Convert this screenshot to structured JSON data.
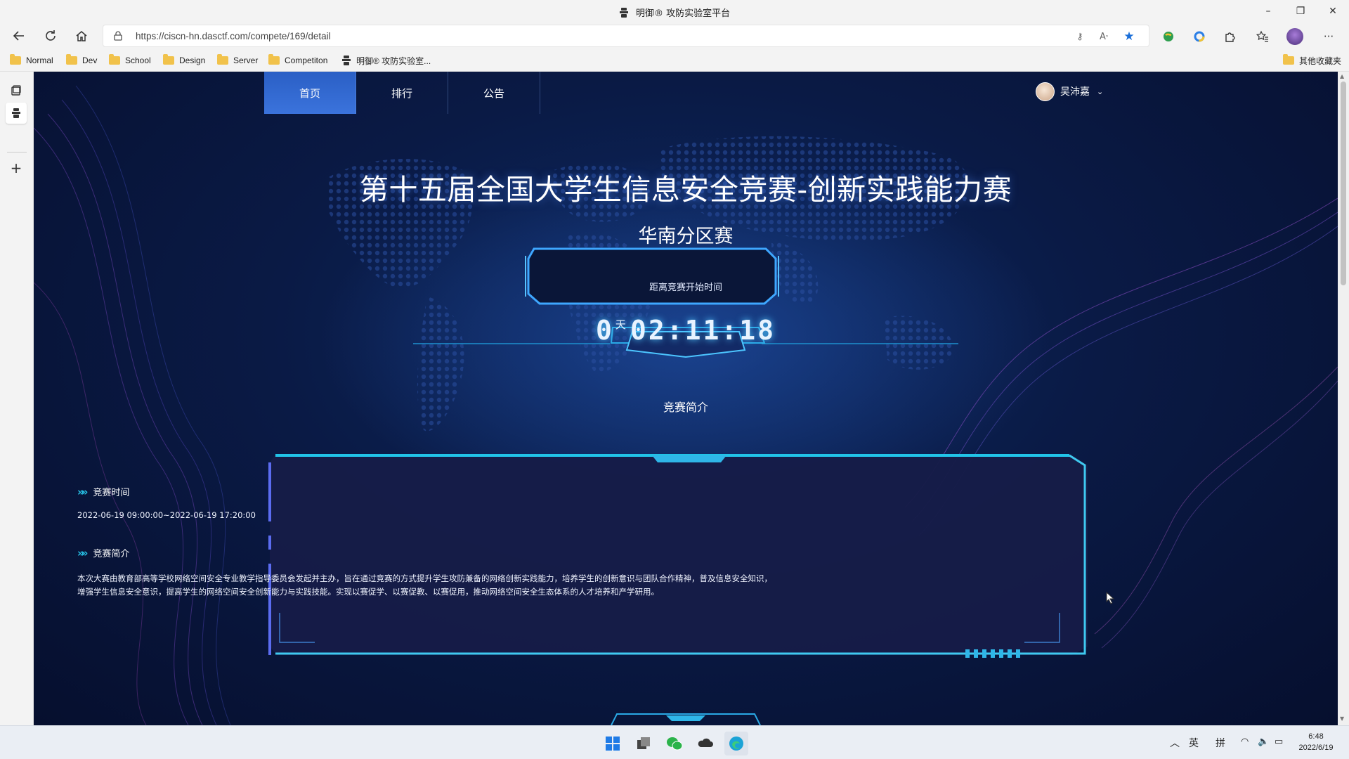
{
  "window": {
    "title": "明御® 攻防实验室平台",
    "controls": {
      "minimize": "–",
      "maximize": "❐",
      "close": "✕"
    }
  },
  "address_bar": {
    "url": "https://ciscn-hn.dasctf.com/compete/169/detail"
  },
  "bookmarks": [
    {
      "label": "Normal",
      "icon": "folder-icon"
    },
    {
      "label": "Dev",
      "icon": "folder-icon"
    },
    {
      "label": "School",
      "icon": "folder-icon"
    },
    {
      "label": "Design",
      "icon": "folder-icon"
    },
    {
      "label": "Server",
      "icon": "folder-icon"
    },
    {
      "label": "Competiton",
      "icon": "folder-icon"
    },
    {
      "label": "明御® 攻防实验室...",
      "icon": "site-logo-icon"
    }
  ],
  "other_bookmarks": "其他收藏夹",
  "site_nav": {
    "tabs": [
      {
        "label": "首页",
        "active": true
      },
      {
        "label": "排行",
        "active": false
      },
      {
        "label": "公告",
        "active": false
      }
    ],
    "user_name": "吴沛嘉",
    "caret": "⌄"
  },
  "hero": {
    "title": "第十五届全国大学生信息安全竞赛-创新实践能力赛",
    "subtitle": "华南分区赛",
    "countdown_label": "距离竞赛开始时间",
    "countdown": {
      "days": "0",
      "day_unit": "天",
      "time": "02:11:18"
    },
    "section_badge": "竞赛简介"
  },
  "details": {
    "time_heading": "竞赛时间",
    "time_value": "2022-06-19 09:00:00~2022-06-19 17:20:00",
    "intro_heading": "竞赛简介",
    "intro_line1": "本次大赛由教育部高等学校网络空间安全专业教学指导委员会发起并主办，旨在通过竞赛的方式提升学生攻防兼备的网络创新实践能力，培养学生的创新意识与团队合作精神，普及信息安全知识，",
    "intro_line2": "增强学生信息安全意识，提高学生的网络空间安全创新能力与实践技能。实现以赛促学、以赛促教、以赛促用，推动网络空间安全生态体系的人才培养和产学研用。"
  },
  "taskbar": {
    "tray_ime1": "英",
    "tray_ime2": "拼",
    "time": "6:48",
    "date": "2022/6/19"
  },
  "colors": {
    "accent_cyan": "#27c3e8",
    "active_tab": "#2f66cf",
    "page_bg": "#0a1a45"
  }
}
